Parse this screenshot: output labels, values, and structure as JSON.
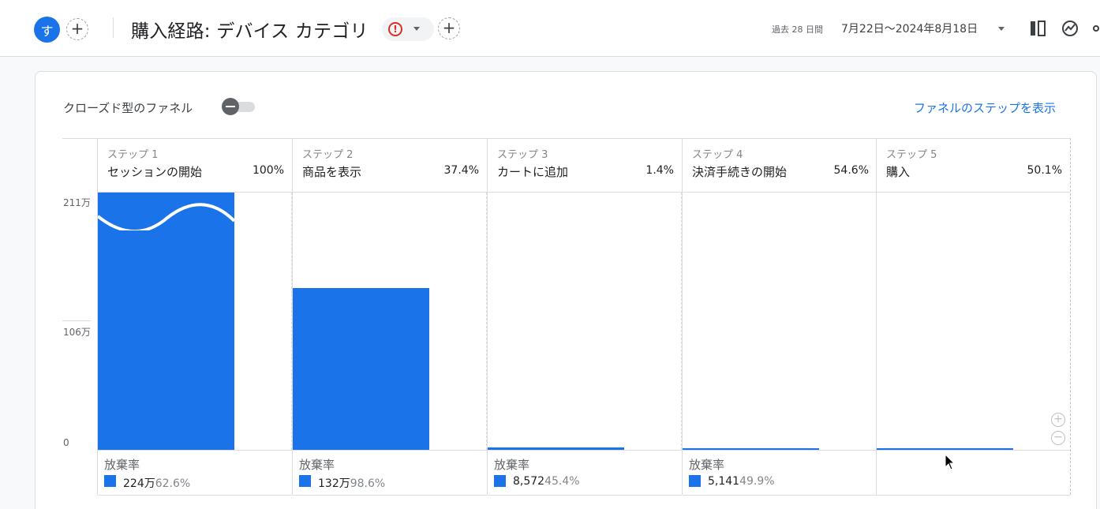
{
  "header": {
    "avatar_letter": "す",
    "add_symbol": "+",
    "report_title": "購入経路: デバイス カテゴリ",
    "warning_symbol": "!",
    "date_prefix": "過去 28 日間",
    "date_range": "7月22日～2024年8月18日"
  },
  "controls": {
    "closed_funnel_label": "クローズド型のファネル",
    "show_steps_link": "ファネルのステップを表示"
  },
  "colors": {
    "accent": "#1a73e8",
    "warning": "#d93025"
  },
  "chart_data": {
    "type": "bar",
    "y_axis_ticks": [
      "211万",
      "106万",
      "0"
    ],
    "ylim": [
      0,
      2110000
    ],
    "steps": [
      {
        "step": "ステップ 1",
        "name": "セッションの開始",
        "percent": "100%",
        "value": 2110000,
        "dropoff_label": "放棄率",
        "dropoff_count": "224万",
        "dropoff_rate": "62.6%"
      },
      {
        "step": "ステップ 2",
        "name": "商品を表示",
        "percent": "37.4%",
        "value": 1330000,
        "dropoff_label": "放棄率",
        "dropoff_count": "132万",
        "dropoff_rate": "98.6%"
      },
      {
        "step": "ステップ 3",
        "name": "カートに追加",
        "percent": "1.4%",
        "value": 18800,
        "dropoff_label": "放棄率",
        "dropoff_count": "8,572",
        "dropoff_rate": "45.4%"
      },
      {
        "step": "ステップ 4",
        "name": "決済手続きの開始",
        "percent": "54.6%",
        "value": 10300,
        "dropoff_label": "放棄率",
        "dropoff_count": "5,141",
        "dropoff_rate": "49.9%"
      },
      {
        "step": "ステップ 5",
        "name": "購入",
        "percent": "50.1%",
        "value": 5150,
        "dropoff_label": "",
        "dropoff_count": "",
        "dropoff_rate": ""
      }
    ]
  }
}
